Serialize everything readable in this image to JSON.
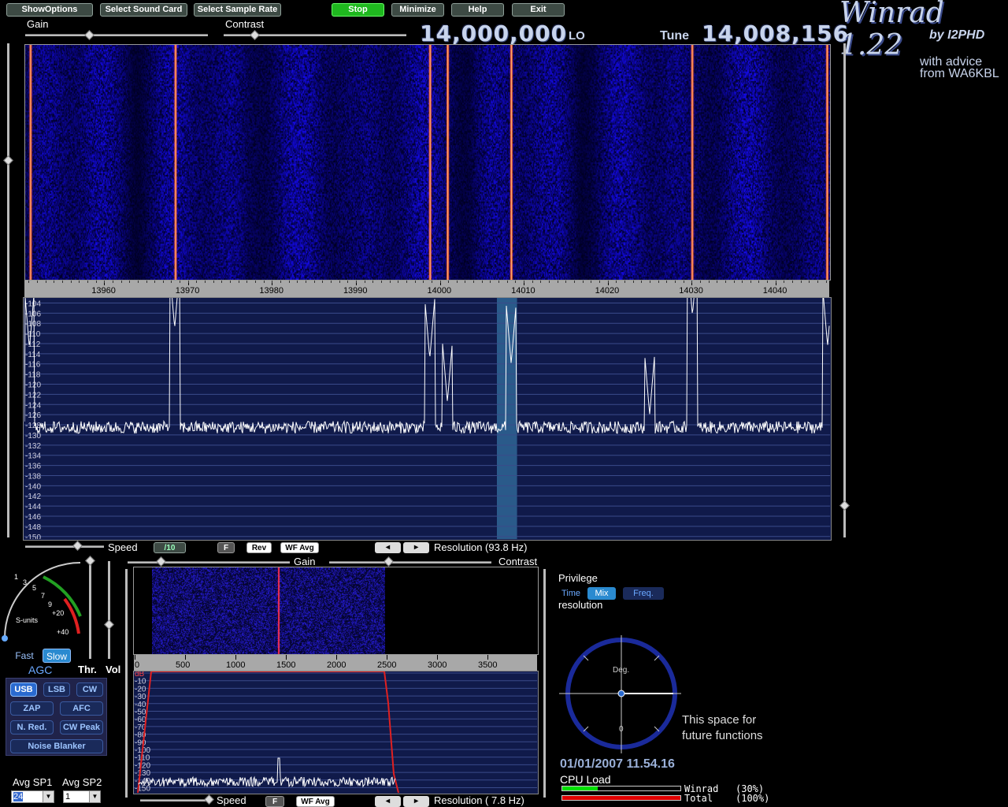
{
  "toolbar": {
    "show_options": "ShowOptions",
    "select_sound_card": "Select Sound Card",
    "select_sample_rate": "Select Sample Rate",
    "stop": "Stop",
    "minimize": "Minimize",
    "help": "Help",
    "exit": "Exit"
  },
  "top_sliders": {
    "gain": "Gain",
    "contrast": "Contrast",
    "gain_level": 0.35,
    "contrast_level": 0.17
  },
  "lo": {
    "value": "14,000,000",
    "unit": "LO"
  },
  "tune": {
    "label": "Tune",
    "value": "14,008,156"
  },
  "brand": {
    "title": "Winrad 1.22",
    "by": "by I2PHD",
    "advice1": "with advice",
    "advice2": "from WA6KBL"
  },
  "main_axis": {
    "ticks": [
      "13960",
      "13970",
      "13980",
      "13990",
      "14000",
      "14010",
      "14020",
      "14030",
      "14040"
    ]
  },
  "main_db": [
    "-104",
    "-106",
    "-108",
    "-110",
    "-112",
    "-114",
    "-116",
    "-118",
    "-120",
    "-122",
    "-124",
    "-126",
    "-128",
    "-130",
    "-132",
    "-134",
    "-136",
    "-138",
    "-140",
    "-142",
    "-144",
    "-146",
    "-148",
    "-150"
  ],
  "main_controls": {
    "speed": "Speed",
    "div10": "/10",
    "f": "F",
    "rev": "Rev",
    "wfavg": "WF Avg",
    "resolution": "Resolution (93.8 Hz)"
  },
  "sub_sliders": {
    "gain": "Gain",
    "contrast": "Contrast"
  },
  "smeter": {
    "units": "S-units",
    "scale": [
      "1",
      "3",
      "5",
      "7",
      "9",
      "+20",
      "+40"
    ]
  },
  "agc": {
    "fast": "Fast",
    "slow": "Slow",
    "label": "AGC",
    "thr": "Thr.",
    "vol": "Vol"
  },
  "modes": {
    "usb": "USB",
    "lsb": "LSB",
    "cw": "CW",
    "zap": "ZAP",
    "afc": "AFC",
    "nred": "N. Red.",
    "cwpeak": "CW Peak",
    "nb": "Noise Blanker"
  },
  "avg": {
    "sp1_label": "Avg SP1",
    "sp2_label": "Avg SP2",
    "sp1": "24",
    "sp2": "1"
  },
  "audio_axis": {
    "ticks": [
      "0",
      "500",
      "1000",
      "1500",
      "2000",
      "2500",
      "3000",
      "3500"
    ]
  },
  "audio_db": [
    "dB",
    "-10",
    "-20",
    "-30",
    "-40",
    "-50",
    "-60",
    "-70",
    "-80",
    "-90",
    "-100",
    "-110",
    "-120",
    "-130",
    "-140",
    "-150"
  ],
  "audio_controls": {
    "speed": "Speed",
    "f": "F",
    "wfavg": "WF Avg",
    "resolution": "Resolution ( 7.8 Hz)"
  },
  "privilege": {
    "title": "Privilege",
    "time": "Time",
    "mix": "Mix",
    "freq": "Freq.",
    "resolution": "resolution"
  },
  "dial": {
    "deg": "Deg.",
    "zero": "0"
  },
  "future": {
    "line1": "This space for",
    "line2": "future functions"
  },
  "timestamp": "01/01/2007 11.54.16",
  "cpu": {
    "label": "CPU Load",
    "winrad_label": "Winrad",
    "winrad_pct": "(30%)",
    "total_label": "Total",
    "total_pct": "(100%)",
    "winrad": 0.3,
    "total": 1.0
  },
  "colors": {
    "waterfall_bg": "#0a0a55",
    "trace": "#ffffff",
    "spectrum_bg": "#101a4a",
    "accent": "#2a6ad0",
    "cpu_winrad": "#00e000",
    "cpu_total": "#e00000"
  }
}
